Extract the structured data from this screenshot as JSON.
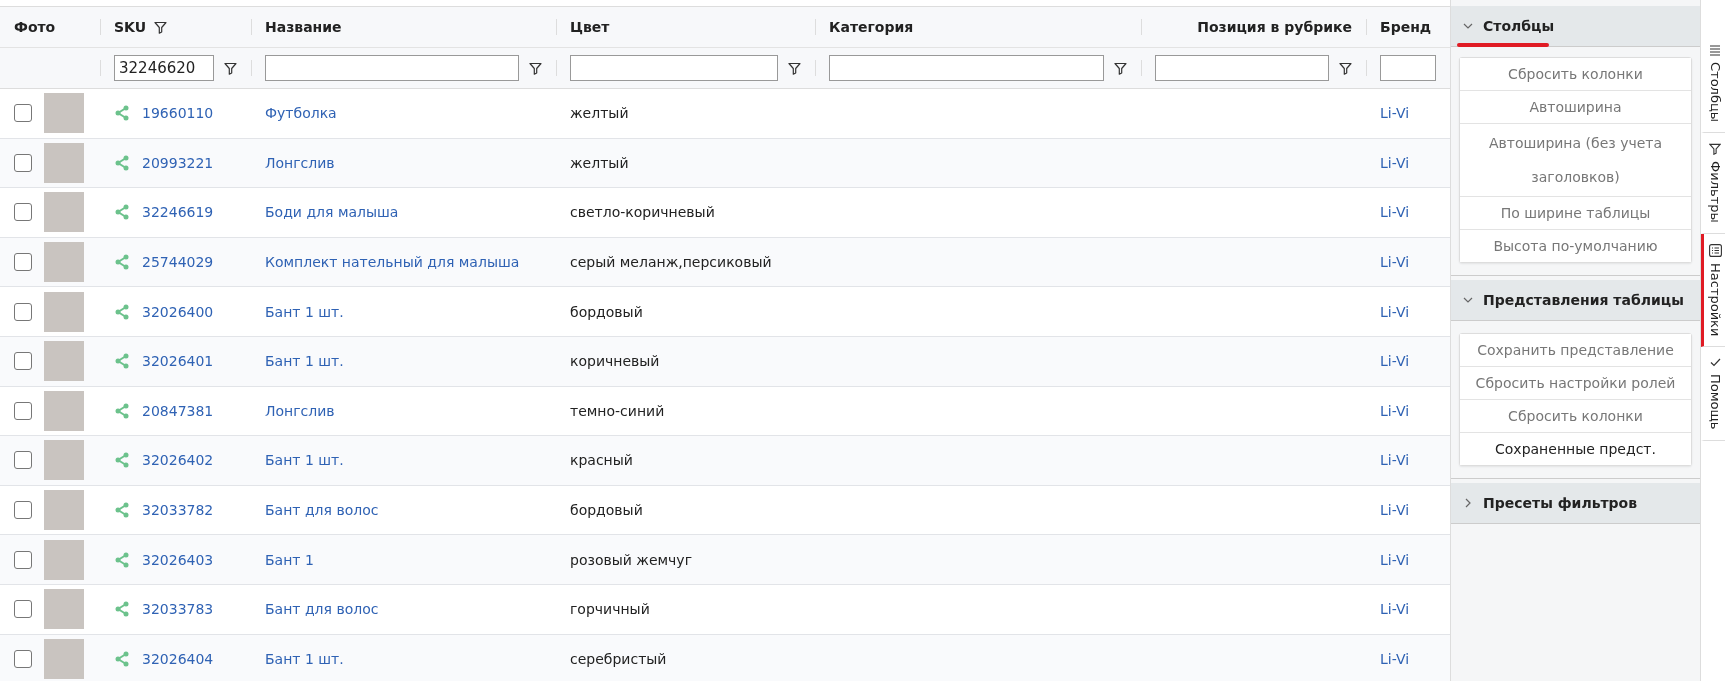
{
  "table": {
    "columns": [
      {
        "label": "Фото",
        "kind": "text",
        "filtered": false,
        "filter_field": false,
        "filter_icon": false
      },
      {
        "label": "SKU",
        "kind": "text",
        "filtered": true,
        "filter_field": true,
        "filter_value": "32246620",
        "filter_icon": true
      },
      {
        "label": "Название",
        "kind": "text",
        "filtered": false,
        "filter_field": true,
        "filter_icon": true
      },
      {
        "label": "Цвет",
        "kind": "text",
        "filtered": false,
        "filter_field": true,
        "filter_icon": true
      },
      {
        "label": "Категория",
        "kind": "text",
        "filtered": false,
        "filter_field": true,
        "filter_icon": true
      },
      {
        "label": "Позиция в рубрике",
        "kind": "number",
        "filtered": false,
        "filter_field": true,
        "filter_icon": true
      },
      {
        "label": "Бренд",
        "kind": "text",
        "filtered": false,
        "filter_field": true,
        "filter_icon": false
      }
    ],
    "rows": [
      {
        "checked": false,
        "sku": "19660110",
        "name": "Футболка",
        "color_name": "желтый",
        "brand": "Li-Vi"
      },
      {
        "checked": false,
        "sku": "20993221",
        "name": "Лонгслив",
        "color_name": "желтый",
        "brand": "Li-Vi"
      },
      {
        "checked": false,
        "sku": "32246619",
        "name": "Боди для малыша",
        "color_name": "светло-коричневый",
        "brand": "Li-Vi"
      },
      {
        "checked": false,
        "sku": "25744029",
        "name": "Комплект нательный для малыша",
        "color_name": "серый меланж,персиковый",
        "brand": "Li-Vi"
      },
      {
        "checked": false,
        "sku": "32026400",
        "name": "Бант 1 шт.",
        "color_name": "бордовый",
        "brand": "Li-Vi"
      },
      {
        "checked": false,
        "sku": "32026401",
        "name": "Бант 1 шт.",
        "color_name": "коричневый",
        "brand": "Li-Vi"
      },
      {
        "checked": false,
        "sku": "20847381",
        "name": "Лонгслив",
        "color_name": "темно-синий",
        "brand": "Li-Vi"
      },
      {
        "checked": false,
        "sku": "32026402",
        "name": "Бант 1 шт.",
        "color_name": "красный",
        "brand": "Li-Vi"
      },
      {
        "checked": false,
        "sku": "32033782",
        "name": "Бант для волос",
        "color_name": "бордовый",
        "brand": "Li-Vi"
      },
      {
        "checked": false,
        "sku": "32026403",
        "name": "Бант 1",
        "color_name": "розовый жемчуг",
        "brand": "Li-Vi"
      },
      {
        "checked": false,
        "sku": "32033783",
        "name": "Бант для волос",
        "color_name": "горчичный",
        "brand": "Li-Vi"
      },
      {
        "checked": false,
        "sku": "32026404",
        "name": "Бант 1 шт.",
        "color_name": "серебристый",
        "brand": "Li-Vi"
      }
    ]
  },
  "panel": {
    "sections": [
      {
        "title": "Столбцы",
        "expanded": true,
        "underlined": true,
        "buttons": [
          {
            "label": "Сбросить колонки",
            "disabled": true
          },
          {
            "label": "Автоширина",
            "disabled": true
          },
          {
            "label": "Автоширина (без учета заголовков)",
            "disabled": true
          },
          {
            "label": "По ширине таблицы",
            "disabled": true
          },
          {
            "label": "Высота по-умолчанию",
            "disabled": true
          }
        ]
      },
      {
        "title": "Представления таблицы",
        "expanded": true,
        "underlined": false,
        "buttons": [
          {
            "label": "Сохранить представление",
            "disabled": true
          },
          {
            "label": "Сбросить настройки ролей",
            "disabled": true
          },
          {
            "label": "Сбросить колонки",
            "disabled": true
          },
          {
            "label": "Сохраненные предст.",
            "disabled": false
          }
        ]
      },
      {
        "title": "Пресеты фильтров",
        "expanded": false,
        "underlined": false
      }
    ]
  },
  "side_tabs": [
    {
      "label": "Столбцы",
      "kind": "columns",
      "selected": false
    },
    {
      "label": "Фильтры",
      "kind": "filters",
      "selected": false
    },
    {
      "label": "Настройки",
      "kind": "settings",
      "selected": true
    },
    {
      "label": "Помощь",
      "kind": "help",
      "selected": false
    }
  ]
}
